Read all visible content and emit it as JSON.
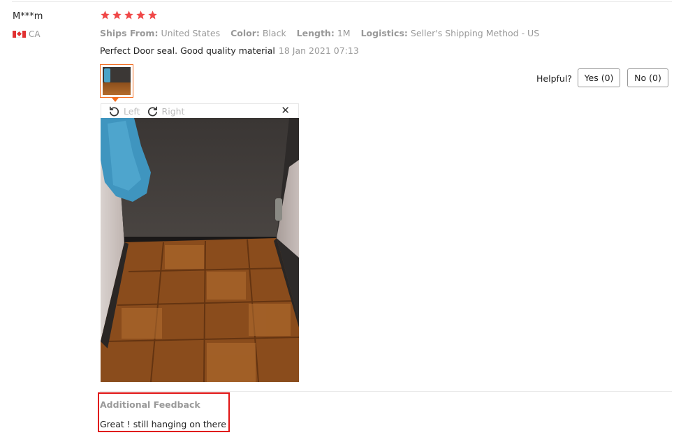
{
  "reviewer": {
    "name": "M***m",
    "country": "CA",
    "flag_icon": "canada-flag-icon"
  },
  "rating": {
    "value": 5,
    "max": 5,
    "star_color": "#f04848"
  },
  "attributes": [
    {
      "key": "Ships From:",
      "value": "United States"
    },
    {
      "key": "Color:",
      "value": "Black"
    },
    {
      "key": "Length:",
      "value": "1M"
    },
    {
      "key": "Logistics:",
      "value": "Seller's Shipping Method - US"
    }
  ],
  "review": {
    "text": "Perfect Door seal. Good quality material",
    "date": "18 Jan 2021 07:13"
  },
  "helpful": {
    "label": "Helpful?",
    "yes_label": "Yes (0)",
    "no_label": "No (0)"
  },
  "viewer": {
    "rotate_left_label": "Left",
    "rotate_right_label": "Right",
    "close_glyph": "✕",
    "accent_color": "#f36d1f"
  },
  "additional_feedback": {
    "title": "Additional Feedback",
    "text": "Great ! still hanging on there",
    "highlight_color": "#e01414"
  }
}
